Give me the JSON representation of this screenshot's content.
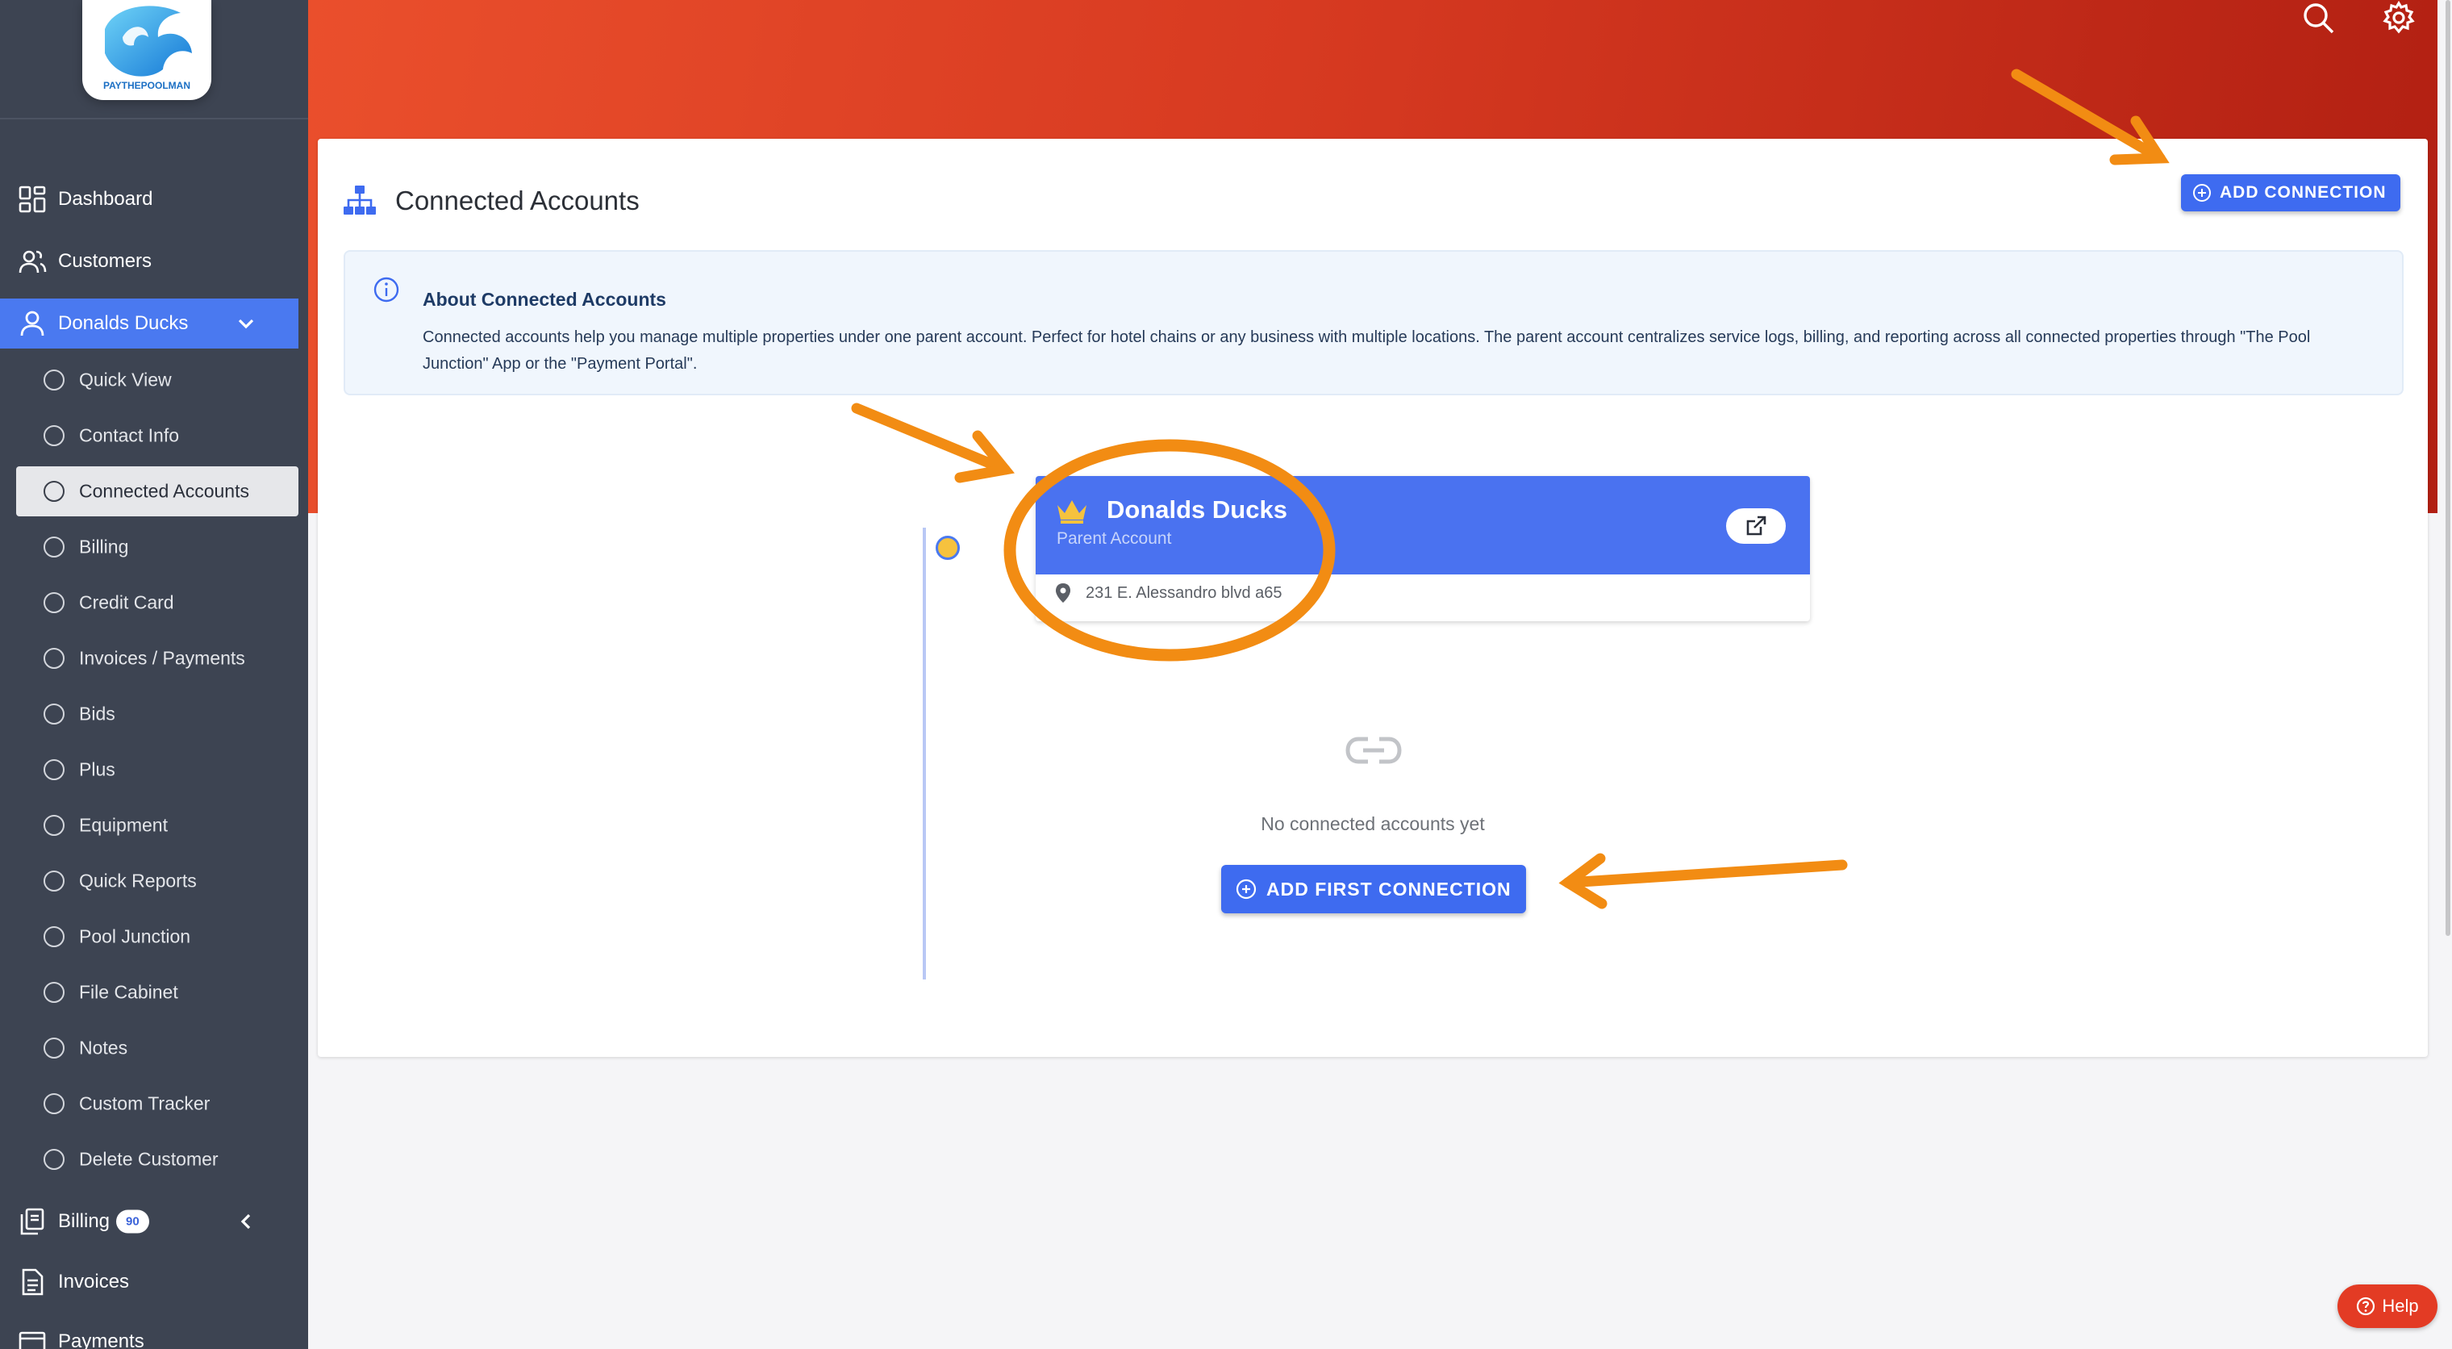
{
  "brand": {
    "logo_text": "PAYTHEPOOLMAN"
  },
  "sidebar": {
    "top_items": [
      {
        "label": "Dashboard",
        "icon": "dashboard-grid-icon"
      },
      {
        "label": "Customers",
        "icon": "users-icon"
      }
    ],
    "active_customer": {
      "label": "Donalds Ducks",
      "icon": "user-icon"
    },
    "sub_items": [
      {
        "label": "Quick View"
      },
      {
        "label": "Contact Info"
      },
      {
        "label": "Connected Accounts",
        "active": true
      },
      {
        "label": "Billing"
      },
      {
        "label": "Credit Card"
      },
      {
        "label": "Invoices / Payments"
      },
      {
        "label": "Bids"
      },
      {
        "label": "Plus"
      },
      {
        "label": "Equipment"
      },
      {
        "label": "Quick Reports"
      },
      {
        "label": "Pool Junction"
      },
      {
        "label": "File Cabinet"
      },
      {
        "label": "Notes"
      },
      {
        "label": "Custom Tracker"
      },
      {
        "label": "Delete Customer"
      }
    ],
    "bottom_items": [
      {
        "label": "Billing",
        "badge": "90",
        "icon": "billing-pages-icon"
      },
      {
        "label": "Invoices",
        "icon": "invoice-doc-icon"
      },
      {
        "label": "Payments",
        "icon": "payments-icon"
      }
    ]
  },
  "header": {
    "search_icon": "search-icon",
    "settings_icon": "gear-icon"
  },
  "main": {
    "title": "Connected Accounts",
    "add_connection_label": "ADD CONNECTION",
    "info": {
      "title": "About Connected Accounts",
      "text": "Connected accounts help you manage multiple properties under one parent account. Perfect for hotel chains or any business with multiple locations. The parent account centralizes service logs, billing, and reporting across all connected properties through \"The Pool Junction\" App or the \"Payment Portal\"."
    },
    "parent": {
      "name": "Donalds Ducks",
      "role": "Parent Account",
      "address": "231 E. Alessandro blvd a65"
    },
    "empty_text": "No connected accounts yet",
    "add_first_label": "ADD FIRST CONNECTION"
  },
  "help": {
    "label": "Help"
  },
  "colors": {
    "sidebar_bg": "#3d4452",
    "accent": "#4a79f0",
    "header_red": "#d73a21",
    "annotation_orange": "#f28c13"
  }
}
